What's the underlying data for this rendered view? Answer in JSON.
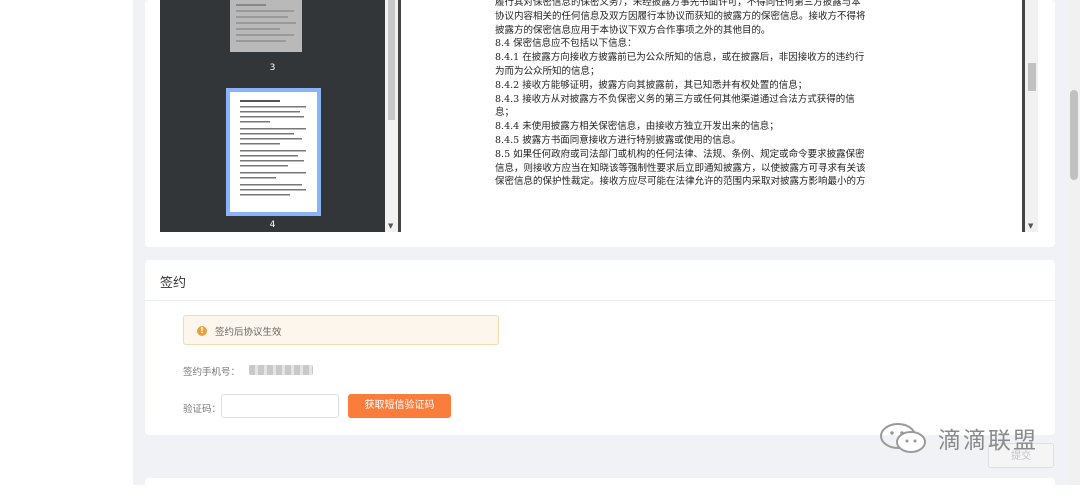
{
  "viewer": {
    "thumbnails": [
      {
        "label": "3",
        "selected": false
      },
      {
        "label": "4",
        "selected": true
      }
    ],
    "document_lines": [
      "履行其对保密信息的保密义务），未经披露方事先书面许可，不得向任何第三方披露与本",
      "协议内容相关的任何信息及双方因履行本协议而获知的披露方的保密信息。接收方不得将",
      "披露方的保密信息应用于本协议下双方合作事项之外的其他目的。",
      "8.4 保密信息应不包括以下信息：",
      "8.4.1 在披露方向接收方披露前已为公众所知的信息，或在披露后，非因接收方的违约行",
      "为而为公众所知的信息；",
      "8.4.2 接收方能够证明，披露方向其披露前，其已知悉并有权处置的信息；",
      "8.4.3 接收方从对披露方不负保密义务的第三方或任何其他渠道通过合法方式获得的信",
      "息；",
      "8.4.4 未使用披露方相关保密信息，由接收方独立开发出来的信息；",
      "8.4.5 披露方书面同意接收方进行特别披露或使用的信息。",
      "8.5 如果任何政府或司法部门或机构的任何法律、法规、条例、规定或命令要求披露保密",
      "信息，则接收方应当在知晓该等强制性要求后立即通知披露方，以使披露方可寻求有关该",
      "保密信息的保护性裁定。接收方应尽可能在法律允许的范围内采取对披露方影响最小的方"
    ]
  },
  "sign": {
    "title": "签约",
    "notice": "签约后协议生效",
    "notice_icon": "warning-icon",
    "phone_label": "签约手机号：",
    "code_label": "验证码：",
    "code_value": "",
    "sms_button": "获取短信验证码",
    "submit_button": "提交"
  },
  "watermark": {
    "text": "滴滴联盟"
  },
  "colors": {
    "accent": "#fa7d3c",
    "notice_bg": "#fdf6ec",
    "notice_icon": "#e6a23c",
    "thumb_select": "#8ab4f8"
  }
}
